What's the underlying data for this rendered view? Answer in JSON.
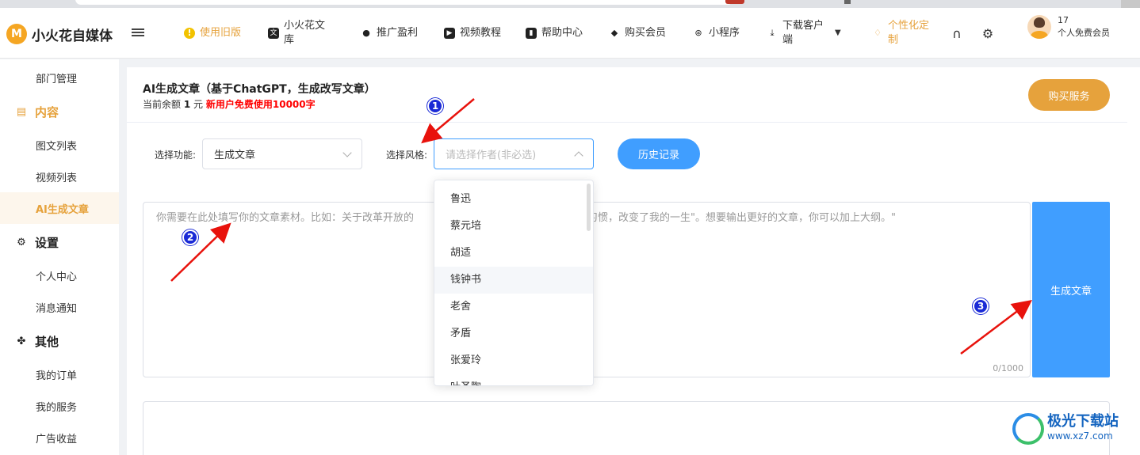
{
  "app": {
    "logo_mark": "M",
    "logo_text": "小火花自媒体"
  },
  "header": {
    "nav": [
      {
        "label": "使用旧版",
        "icon": "info-icon"
      },
      {
        "label": "小火花文库",
        "icon": "document-icon"
      },
      {
        "label": "推广盈利",
        "icon": "money-bag-icon"
      },
      {
        "label": "视频教程",
        "icon": "video-icon"
      },
      {
        "label": "帮助中心",
        "icon": "book-icon"
      },
      {
        "label": "购买会员",
        "icon": "diamond-icon"
      },
      {
        "label": "小程序",
        "icon": "miniprogram-icon"
      },
      {
        "label": "下载客户端",
        "icon": "download-icon"
      },
      {
        "label": "个性化定制",
        "icon": "gem-icon"
      }
    ],
    "user_id": "17",
    "user_level": "个人免费会员"
  },
  "sidebar": {
    "items": [
      {
        "label": "部门管理"
      },
      {
        "label": "内容"
      },
      {
        "label": "图文列表"
      },
      {
        "label": "视频列表"
      },
      {
        "label": "AI生成文章"
      },
      {
        "label": "设置"
      },
      {
        "label": "个人中心"
      },
      {
        "label": "消息通知"
      },
      {
        "label": "其他"
      },
      {
        "label": "我的订单"
      },
      {
        "label": "我的服务"
      },
      {
        "label": "广告收益"
      }
    ]
  },
  "main": {
    "title": "AI生成文章（基于ChatGPT，生成改写文章）",
    "balance_prefix": "当前余额",
    "balance_value": "1",
    "balance_unit": "元",
    "promo": "新用户免费使用10000字",
    "buy_label": "购买服务",
    "function_label": "选择功能:",
    "function_value": "生成文章",
    "style_label": "选择风格:",
    "style_placeholder": "请选择作者(非必选)",
    "history_label": "历史记录",
    "textarea_placeholder_left": "你需要在此处填写你的文章素材。比如：关于改革开放的",
    "textarea_placeholder_right": "个习惯，改变了我的一生\"。想要输出更好的文章，你可以加上大纲。\"",
    "counter": "0/1000",
    "generate_label": "生成文章"
  },
  "dropdown": {
    "options": [
      "鲁迅",
      "蔡元培",
      "胡适",
      "钱钟书",
      "老舍",
      "矛盾",
      "张爱玲",
      "叶圣陶"
    ],
    "hovered_index": 3
  },
  "annotations": {
    "markers": [
      "1",
      "2",
      "3"
    ],
    "arrow_color": "#e8120c",
    "marker_color": "#1a2ad6"
  },
  "watermark": {
    "title": "极光下载站",
    "url": "www.xz7.com"
  },
  "colors": {
    "accent_orange": "#e6a23c",
    "primary_blue": "#409eff",
    "promo_red": "#ff0000"
  }
}
